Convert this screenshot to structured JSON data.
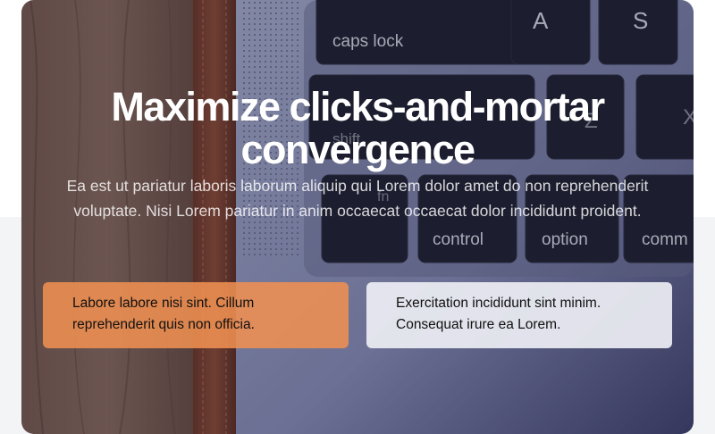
{
  "hero": {
    "title": "Maximize clicks-and-mortar convergence",
    "description": "Ea est ut pariatur laboris laborum aliquip qui Lorem dolor amet do non reprehenderit voluptate. Nisi Lorem pariatur in anim occaecat occaecat dolor incididunt proident.",
    "photo": {
      "keys": {
        "a": "A",
        "s": "S",
        "caps": "caps lock",
        "shift": "shift",
        "z": "Z",
        "x": "X",
        "fn": "fn",
        "control": "control",
        "option": "option",
        "command": "comm"
      }
    }
  },
  "cards": [
    {
      "text": "Labore labore nisi sint. Cillum reprehenderit quis non officia.",
      "color": "#ef8f52"
    },
    {
      "text": "Exercitation incididunt sint minim. Consequat irure ea Lorem.",
      "color": "#ecedf3"
    }
  ],
  "colors": {
    "page_background": "#ffffff",
    "lower_band": "#f3f4f6",
    "title_text": "#ffffff",
    "card_text": "#111111"
  }
}
